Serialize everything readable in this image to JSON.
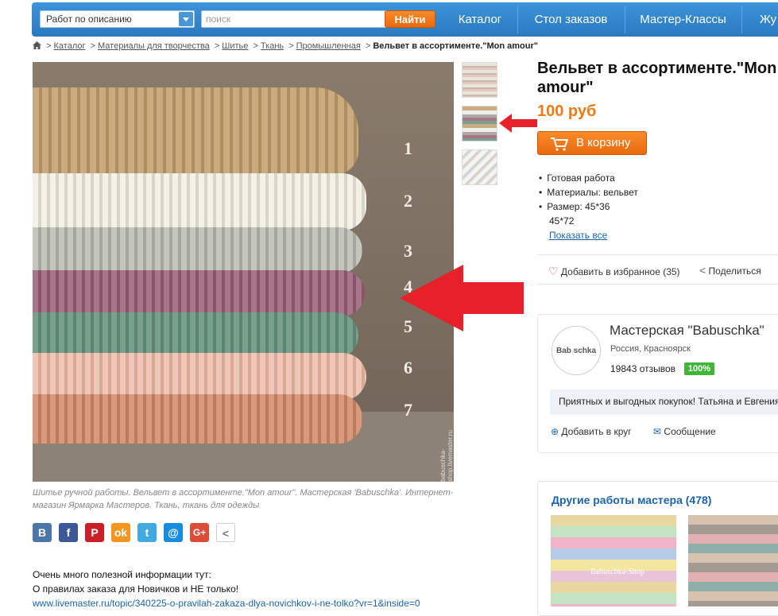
{
  "header": {
    "search_type": "Работ по описанию",
    "search_placeholder": "поиск",
    "search_button": "Найти",
    "nav": [
      "Каталог",
      "Стол заказов",
      "Мастер-Классы",
      "Жу"
    ]
  },
  "breadcrumb": [
    "Каталог",
    "Материалы для творчества",
    "Шитье",
    "Ткань",
    "Промышленная"
  ],
  "breadcrumb_current": "Вельвет в ассортименте.\"Mon amour\"",
  "image": {
    "layer_numbers": [
      "1",
      "2",
      "3",
      "4",
      "5",
      "6",
      "7"
    ],
    "watermark": "babuschka-shop.livemaster.ru"
  },
  "caption": "Шитье ручной работы. Вельвет в ассортименте.\"Mon amour\". Мастерская 'Babuschka'. Интернет-магазин Ярмарка Мастеров. Ткань, ткань для одежды",
  "share_icons": [
    "vk-icon",
    "facebook-icon",
    "pinterest-icon",
    "odnoklassniki-icon",
    "twitter-icon",
    "mail-icon",
    "google-plus-icon",
    "share-icon"
  ],
  "info": {
    "line1": "Очень много полезной информации тут:",
    "line2": "О правилах заказа для Новичков и НЕ только!",
    "link": "www.livemaster.ru/topic/340225-o-pravilah-zakaza-dlya-novichkov-i-ne-tolko?vr=1&inside=0"
  },
  "product": {
    "title": "Вельвет в ассортименте.\"Mon amour\"",
    "price": "100 руб",
    "cart_button": "В корзину",
    "details": [
      "Готовая работа",
      "Материалы: вельвет",
      "Размер: 45*36",
      "45*72"
    ],
    "show_all": "Показать все",
    "favorite": "Добавить в избранное (35)",
    "share": "Поделиться"
  },
  "shop": {
    "name": "Мастерская \"Babuschka\"",
    "location": "Россия, Красноярск",
    "reviews": "19843 отзывов",
    "rating": "100%",
    "greeting": "Приятных и выгодных покупок! Татьяна и Евгения",
    "add_circle": "Добавить в круг",
    "message": "Сообщение",
    "logo_text": "Bab schka"
  },
  "other_works": {
    "title": "Другие работы мастера (478)",
    "watermark": "Babuschka-Shop"
  },
  "colors": {
    "nav_blue": "#2f82c8",
    "orange": "#f07a13",
    "link_blue": "#1a64ad",
    "arrow_red": "#e8202a",
    "rating_green": "#3fb638"
  }
}
